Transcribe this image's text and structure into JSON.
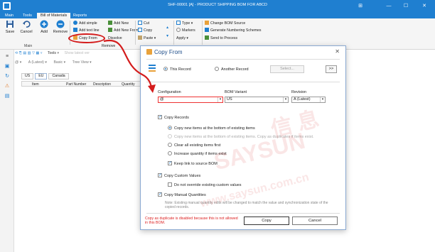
{
  "window": {
    "title": "SHF-00001 [A] - PRODUCT SHIPPING BOM FOR ABCD",
    "min_glyph": "—",
    "max_glyph": "☐",
    "close_glyph": "✕",
    "extra_glyph": "⊞"
  },
  "menu": {
    "tabs": [
      "Main",
      "Tools",
      "Bill of Materials",
      "Reports"
    ],
    "active": "Bill of Materials"
  },
  "ribbon": {
    "save": "Save",
    "cancel": "Cancel",
    "add": "Add",
    "remove": "Remove",
    "group_main": "Main",
    "add_simple": "Add simple",
    "add_text_line": "Add text line",
    "copy_from": "Copy From",
    "add_new": "Add New",
    "add_new_from": "Add New From",
    "dissolve": "Dissolve",
    "remove_small": "Remove",
    "cut": "Cut",
    "copy": "Copy",
    "paste": "Paste",
    "type": "Type",
    "markers": "Markers",
    "apply": "Apply",
    "change_bom_source": "Change BOM Source",
    "generate_numbering": "Generate Numbering Schemes",
    "send_to_process": "Send to Process"
  },
  "workspace": {
    "latest_label": "A (Latest)",
    "basic_label": "Basic",
    "tools_label": "Tools",
    "show_latest": "Show latest ver",
    "tree_view": "Tree View",
    "tabs": [
      "US",
      "EU",
      "Canada"
    ],
    "grid_cols": [
      "Item",
      "Part Number",
      "Description",
      "Quantity"
    ]
  },
  "dialog": {
    "title": "Copy From",
    "close": "✕",
    "radio_this_record": "This Record",
    "radio_another_record": "Another Record",
    "select_placeholder": "Select...",
    "browse_btn": ">>",
    "config_label": "Configuration",
    "config_value": "@",
    "bom_variant_label": "BOM Variant",
    "bom_variant_value": "US",
    "revision_label": "Revision",
    "revision_value": "A (Latest)",
    "copy_records": "Copy Records",
    "opt_copy_new_bottom": "Copy new items at the bottom of existing items",
    "opt_copy_new_dup": "Copy new items at the bottom of existing items. Copy as duplicates if items exist.",
    "opt_clear_first": "Clear all existing items first",
    "opt_increase_qty": "Increase quantity if items exist",
    "keep_link": "Keep link to source BOM",
    "copy_custom_values": "Copy Custom Values",
    "do_not_override": "Do not override existing custom values",
    "copy_manual_quantities": "Copy Manual Quantities",
    "note": "Note: Existing manual quantity edits will be changed to match the value and synchronization state of the copied records.",
    "error": "Copy as duplicate is disabled because this is not allowed in this BOM.",
    "copy_btn": "Copy",
    "cancel_btn": "Cancel"
  },
  "watermark": {
    "text1": "SAYSUN",
    "text2": "信 息",
    "text3": "www.saysun.com.cn"
  },
  "colors": {
    "accent": "#1f7fd0",
    "annotation": "#d41c1c"
  }
}
